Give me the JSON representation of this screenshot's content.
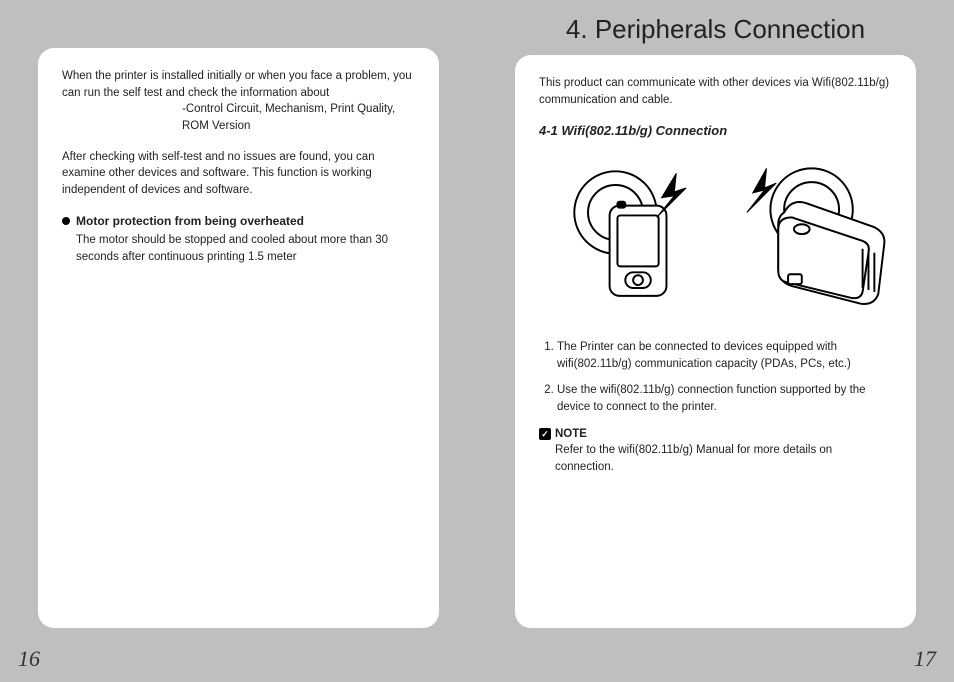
{
  "left": {
    "page_number": "16",
    "p1": "When the printer is installed initially or when you face a problem, you can run the self test and check the information about",
    "p1_sub": "-Control Circuit, Mechanism, Print Quality, ROM Version",
    "p2": "After checking with self-test and no issues are found, you can examine other devices and software. This function is working independent of devices and software.",
    "bullet_title": "Motor protection from being overheated",
    "bullet_body": "The motor should be stopped and cooled about more than 30 seconds after continuous printing 1.5 meter"
  },
  "right": {
    "page_number": "17",
    "chapter": "4. Peripherals Connection",
    "intro": "This product can communicate with other devices via Wifi(802.11b/g) communication and cable.",
    "subtitle": "4-1 Wifi(802.11b/g) Connection",
    "li1": "The Printer can be connected to devices equipped with wifi(802.11b/g) communication capacity (PDAs, PCs, etc.)",
    "li2": "Use the wifi(802.11b/g) connection function supported by the device to connect  to the printer.",
    "note_label": "NOTE",
    "note_body": "Refer to the wifi(802.11b/g)  Manual for more details on connection.",
    "note_check": "✓"
  }
}
